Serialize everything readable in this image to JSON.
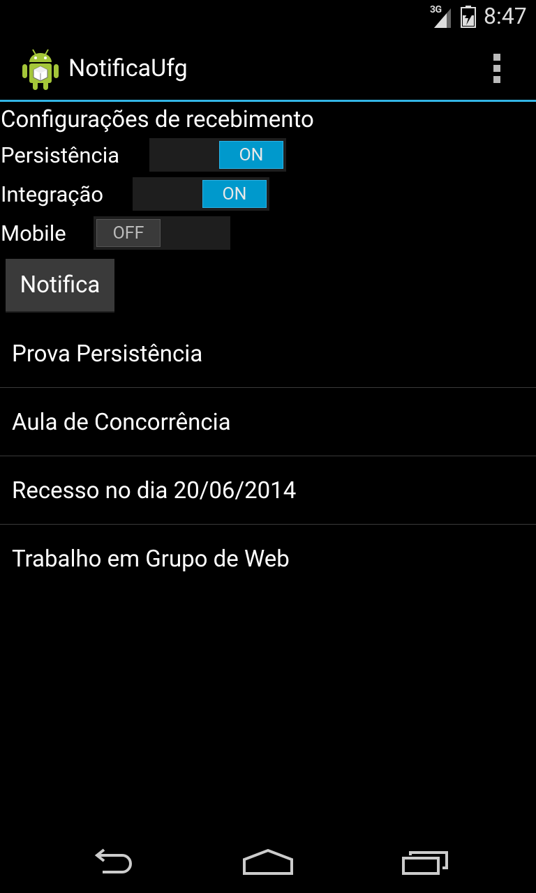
{
  "status_bar": {
    "network_label": "3G",
    "time": "8:47",
    "icons": [
      "signal-icon",
      "battery-icon"
    ]
  },
  "action_bar": {
    "title": "NotificaUfg",
    "app_icon": "android-app-icon",
    "overflow_icon": "overflow-menu-icon",
    "accent_color": "#33b5e5"
  },
  "settings": {
    "title": "Configurações de recebimento",
    "rows": [
      {
        "label": "Persistência",
        "state": "ON",
        "checked": true
      },
      {
        "label": "Integração",
        "state": "ON",
        "checked": true
      },
      {
        "label": "Mobile",
        "state": "OFF",
        "checked": false
      }
    ]
  },
  "notifica_button": {
    "label": "Notifica"
  },
  "notifications": [
    {
      "text": "Prova Persistência"
    },
    {
      "text": "Aula de Concorrência"
    },
    {
      "text": "Recesso no dia 20/06/2014"
    },
    {
      "text": "Trabalho em Grupo de Web"
    }
  ],
  "nav_bar": {
    "icons": [
      "back-icon",
      "home-icon",
      "recent-apps-icon"
    ]
  }
}
